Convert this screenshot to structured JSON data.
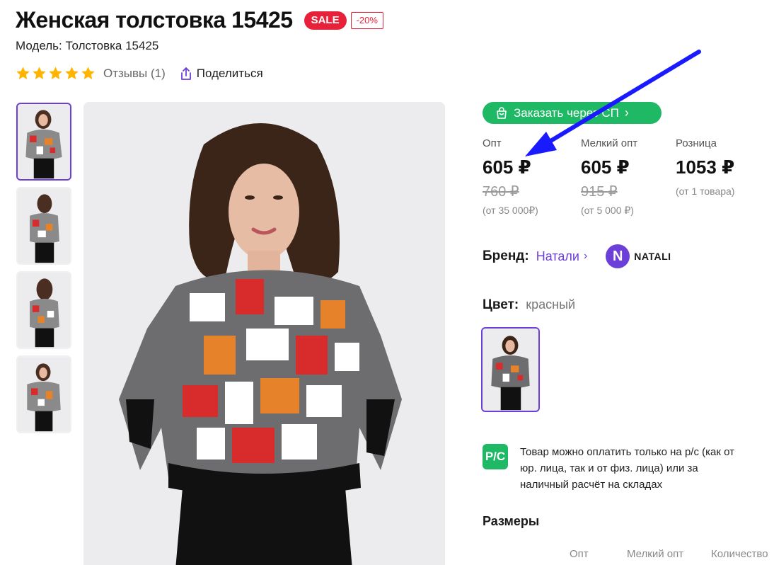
{
  "product": {
    "title": "Женская толстовка 15425",
    "sale_badge": "SALE",
    "discount_badge": "-20%",
    "model": "Модель: Толстовка 15425",
    "rating_stars": 5,
    "reviews": "Отзывы (1)",
    "share": "Поделиться"
  },
  "order_button": {
    "label": "Заказать через СП",
    "chevron": "›"
  },
  "prices": [
    {
      "label": "Опт",
      "price": "605 ₽",
      "old": "760 ₽",
      "note": "(от 35 000₽)"
    },
    {
      "label": "Мелкий опт",
      "price": "605 ₽",
      "old": "915 ₽",
      "note": "(от 5 000 ₽)"
    },
    {
      "label": "Розница",
      "price": "1053 ₽",
      "old": "",
      "note": "(от 1 товара)"
    }
  ],
  "brand": {
    "label": "Бренд:",
    "name": "Натали",
    "chevron": "›",
    "logo_letter": "N",
    "logo_text": "NATALI"
  },
  "color": {
    "label": "Цвет:",
    "value": "красный"
  },
  "payment": {
    "icon_text": "Р/С",
    "text": "Товар можно оплатить только на р/с (как от юр. лица, так и от физ. лица) или за наличный расчёт на складах"
  },
  "sizes": {
    "title": "Размеры",
    "columns": [
      "Опт",
      "Мелкий опт",
      "Количество"
    ]
  },
  "colors": {
    "accent": "#6b3fd8",
    "green": "#1fb865",
    "sale": "#e8213a",
    "star": "#ffb400",
    "arrow": "#1a1aff"
  }
}
